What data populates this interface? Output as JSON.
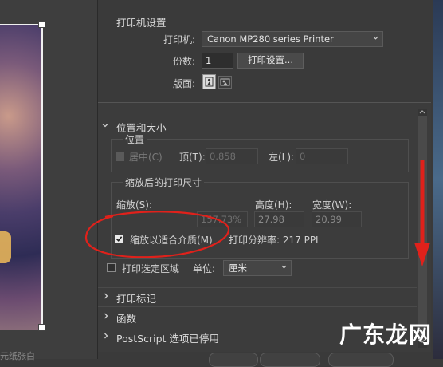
{
  "preview": {
    "caption": "元纸张白"
  },
  "printer_settings": {
    "title": "打印机设置",
    "printer_label": "打印机:",
    "printer_value": "Canon MP280 series Printer",
    "copies_label": "份数:",
    "copies_value": "1",
    "print_settings_button": "打印设置...",
    "layout_label": "版面:"
  },
  "position_size": {
    "title": "位置和大小",
    "position": {
      "title": "位置",
      "center_label": "居中(C)",
      "top_label": "顶(T):",
      "top_value": "0.858",
      "left_label": "左(L):",
      "left_value": "0"
    },
    "scaled_size": {
      "title": "缩放后的打印尺寸",
      "scale_label": "缩放(S):",
      "scale_value": "157.73%",
      "height_label": "高度(H):",
      "height_value": "27.98",
      "width_label": "宽度(W):",
      "width_value": "20.99",
      "fit_media_label": "缩放以适合介质(M)",
      "fit_media_checked": true,
      "resolution": "打印分辨率: 217 PPI"
    },
    "print_selected_label": "打印选定区域",
    "unit_label": "单位:",
    "unit_value": "厘米"
  },
  "collapsed_sections": [
    {
      "label": "打印标记"
    },
    {
      "label": "函数"
    },
    {
      "label": "PostScript 选项已停用"
    }
  ],
  "watermark": "广东龙网",
  "colors": {
    "annotation_red": "#e0211b",
    "background": "#3a3a3a"
  }
}
